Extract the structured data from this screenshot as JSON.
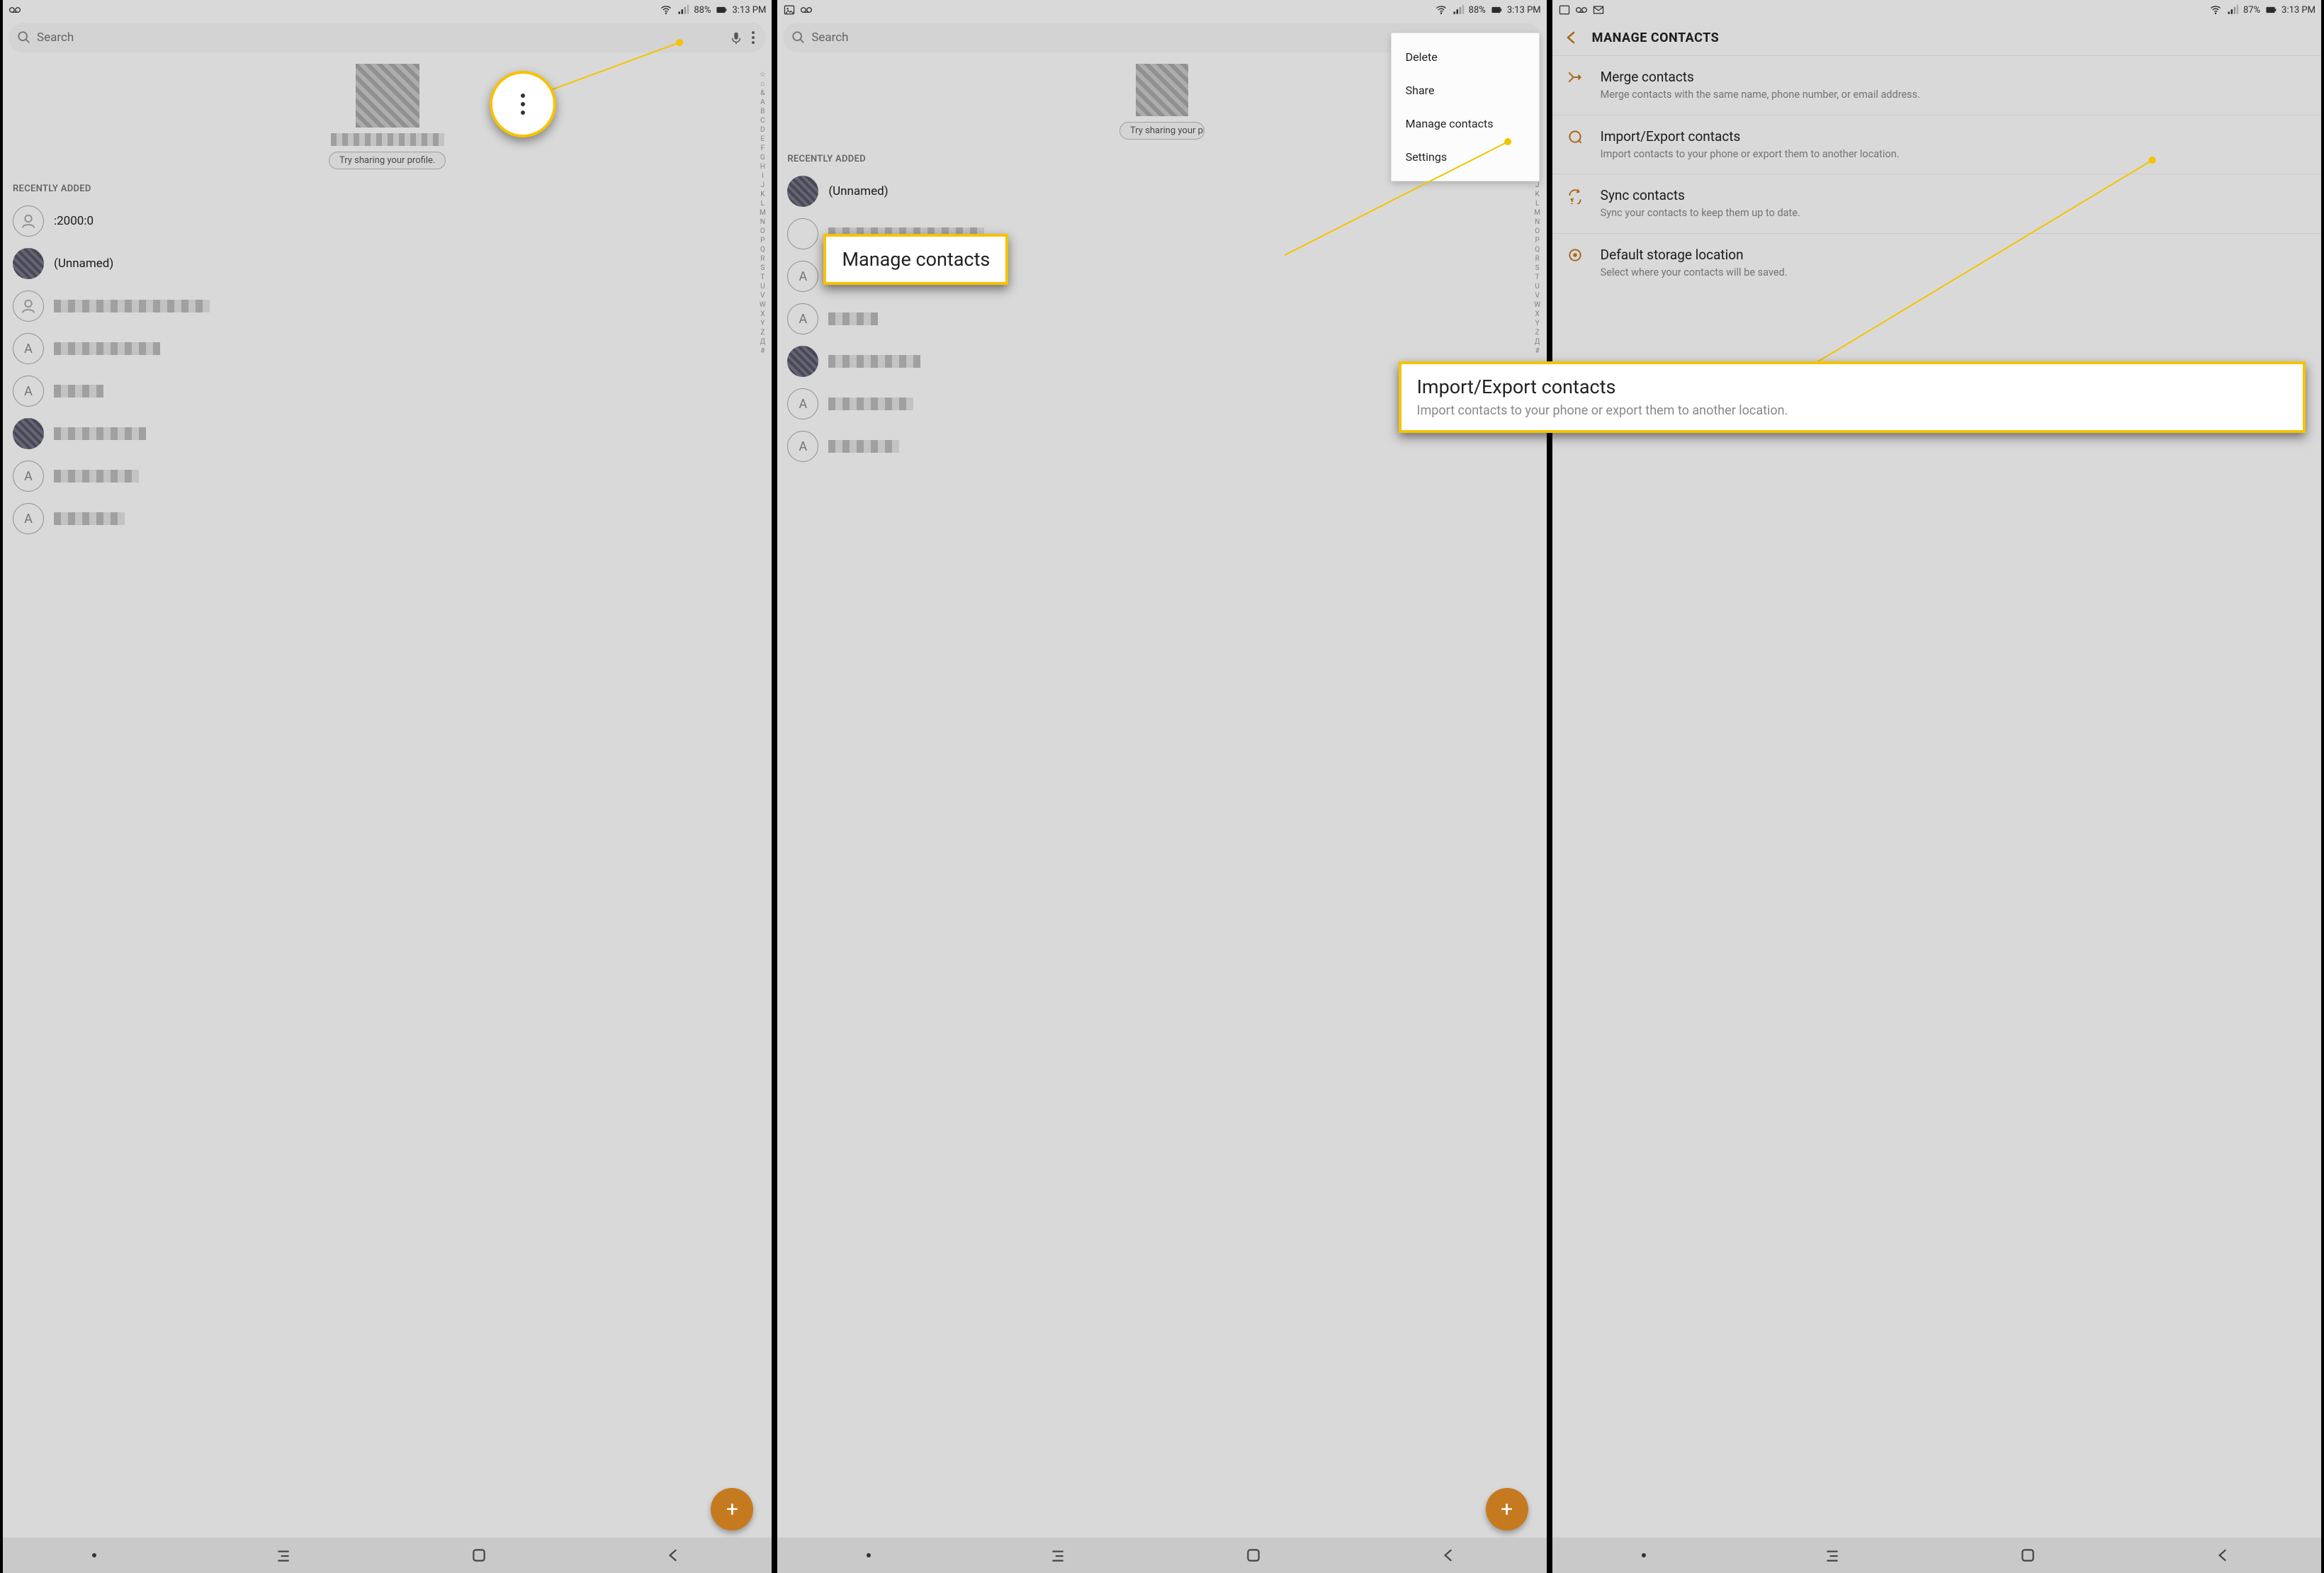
{
  "status1": {
    "battery": "88%",
    "time": "3:13 PM"
  },
  "status2": {
    "battery": "88%",
    "time": "3:13 PM"
  },
  "status3": {
    "battery": "87%",
    "time": "3:13 PM"
  },
  "search": {
    "placeholder": "Search"
  },
  "profile": {
    "try_share": "Try sharing your profile."
  },
  "section": {
    "recently_added": "RECENTLY ADDED"
  },
  "contacts": {
    "c0": {
      "name": ":2000:0"
    },
    "c1": {
      "name": "(Unnamed)"
    },
    "letter": "A"
  },
  "index_labels": [
    "☆",
    "⌂",
    "&",
    "A",
    "B",
    "C",
    "D",
    "E",
    "F",
    "G",
    "H",
    "I",
    "J",
    "K",
    "L",
    "M",
    "N",
    "O",
    "P",
    "Q",
    "R",
    "S",
    "T",
    "U",
    "V",
    "W",
    "X",
    "Y",
    "Z",
    "Д",
    "#"
  ],
  "fab": "+",
  "popup": {
    "delete": "Delete",
    "share": "Share",
    "manage": "Manage contacts",
    "settings": "Settings"
  },
  "callout2": {
    "title": "Manage contacts"
  },
  "callout3": {
    "title": "Import/Export contacts",
    "sub": "Import contacts to your phone or export them to another location."
  },
  "manage": {
    "title": "MANAGE CONTACTS",
    "merge": {
      "t": "Merge contacts",
      "s": "Merge contacts with the same name, phone number, or email address."
    },
    "ie": {
      "t": "Import/Export contacts",
      "s": "Import contacts to your phone or export them to another location."
    },
    "sync": {
      "t": "Sync contacts",
      "s": "Sync your contacts to keep them up to date."
    },
    "def": {
      "t": "Default storage location",
      "s": "Select where your contacts will be saved."
    }
  }
}
